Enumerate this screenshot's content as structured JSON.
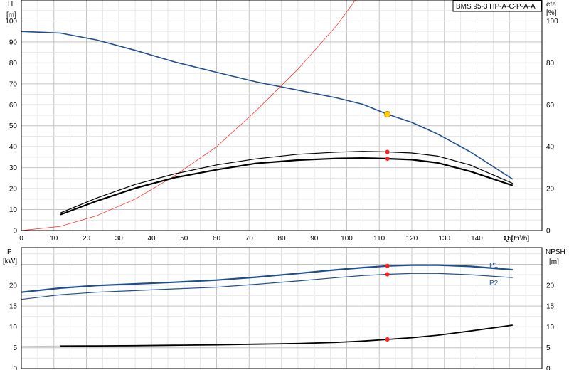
{
  "chart_data": [
    {
      "type": "line",
      "title": "BMS 95-3 HP-A-C-P-A-A",
      "ylabel": "H",
      "yunit": "[m]",
      "y2label": "eta",
      "y2unit": "[%]",
      "xlabel": "Q [m³/h]",
      "xlim": [
        0,
        160
      ],
      "ylim": [
        0,
        110
      ],
      "y2lim": [
        0,
        110
      ],
      "x_ticks": [
        0,
        10,
        20,
        30,
        40,
        50,
        60,
        70,
        80,
        90,
        100,
        110,
        120,
        130,
        140,
        150
      ],
      "y_ticks": [
        0,
        10,
        20,
        30,
        40,
        50,
        60,
        70,
        80,
        90,
        100
      ],
      "y2_ticks": [
        0,
        20,
        40,
        60,
        80,
        100
      ],
      "grid": true,
      "operating_point": {
        "x": 112.5,
        "y": 55.5,
        "color": "#ffcc00"
      },
      "series": [
        {
          "axis": "left",
          "color": "#1f4e8c",
          "width": 1.6,
          "x": [
            0,
            12,
            23,
            35,
            47,
            60,
            72,
            85,
            97,
            105,
            112.5,
            120,
            128,
            138,
            151
          ],
          "values": [
            95,
            94.2,
            91,
            86,
            80.5,
            75.5,
            71,
            67,
            63.3,
            60.2,
            55.5,
            51.6,
            46,
            37.5,
            24.5
          ]
        },
        {
          "axis": "right",
          "color": "#ff2020",
          "width": 0.7,
          "x": [
            0,
            12,
            23,
            35,
            47,
            60,
            72,
            85,
            97,
            105,
            112.5
          ],
          "values": [
            0,
            2,
            7,
            15,
            26,
            40,
            57,
            77,
            98,
            115,
            130
          ]
        },
        {
          "axis": "left",
          "color": "#000000",
          "width": 1.2,
          "x": [
            12,
            23,
            35,
            47,
            60,
            72,
            85,
            97,
            105,
            112.5,
            120,
            128,
            138,
            151
          ],
          "values": [
            8.4,
            15.4,
            22,
            27,
            31.3,
            34.2,
            36.4,
            37.4,
            37.8,
            37.5,
            37,
            35.5,
            31.2,
            22.5
          ]
        },
        {
          "axis": "left",
          "color": "#000000",
          "width": 2.2,
          "x": [
            12,
            23,
            35,
            47,
            60,
            72,
            85,
            97,
            105,
            112.5,
            120,
            128,
            138,
            151
          ],
          "values": [
            7.6,
            14,
            20.2,
            25.2,
            29,
            32,
            33.6,
            34.4,
            34.6,
            34.3,
            33.8,
            32.3,
            28.2,
            21.5
          ]
        }
      ],
      "markers": [
        {
          "x": 112.5,
          "y": 37.5,
          "color": "#ff2020"
        },
        {
          "x": 112.5,
          "y": 34.3,
          "color": "#ff2020"
        }
      ]
    },
    {
      "type": "line",
      "ylabel": "P",
      "yunit": "[kW]",
      "y2label": "NPSH",
      "y2unit": "[m]",
      "xlim": [
        0,
        160
      ],
      "ylim": [
        0,
        29
      ],
      "y2lim": [
        0,
        29
      ],
      "y_ticks": [
        0,
        5,
        10,
        15,
        20
      ],
      "y2_ticks": [
        0,
        5,
        10,
        15,
        20
      ],
      "grid": true,
      "series": [
        {
          "name": "P1",
          "axis": "left",
          "color": "#1f4e8c",
          "width": 2.2,
          "x": [
            0,
            12,
            23,
            35,
            47,
            60,
            72,
            85,
            97,
            105,
            112.5,
            120,
            128,
            138,
            151
          ],
          "values": [
            18.3,
            19.3,
            19.9,
            20.3,
            20.7,
            21.2,
            21.9,
            22.8,
            23.7,
            24.2,
            24.6,
            24.8,
            24.8,
            24.5,
            23.7
          ]
        },
        {
          "name": "P2",
          "axis": "left",
          "color": "#1f4e8c",
          "width": 1.2,
          "x": [
            0,
            12,
            23,
            35,
            47,
            60,
            72,
            85,
            97,
            105,
            112.5,
            120,
            128,
            138,
            151
          ],
          "values": [
            16.6,
            17.7,
            18.3,
            18.7,
            19.1,
            19.5,
            20.2,
            21,
            21.8,
            22.3,
            22.6,
            22.8,
            22.8,
            22.5,
            21.8
          ]
        },
        {
          "axis": "right",
          "color": "#000000",
          "width": 1.8,
          "x": [
            12,
            23,
            35,
            47,
            60,
            72,
            85,
            97,
            105,
            112.5,
            120,
            128,
            138,
            151
          ],
          "values": [
            5.4,
            5.45,
            5.5,
            5.6,
            5.7,
            5.85,
            6,
            6.3,
            6.6,
            7,
            7.4,
            8,
            9,
            10.4
          ]
        },
        {
          "axis": "right",
          "color": "#c0c0c0",
          "width": 1.0,
          "x": [
            0,
            12
          ],
          "values": [
            5.3,
            5.4
          ]
        }
      ],
      "markers": [
        {
          "x": 112.5,
          "y": 24.6,
          "color": "#ff2020"
        },
        {
          "x": 112.5,
          "y": 22.6,
          "color": "#ff2020"
        },
        {
          "x": 112.5,
          "y": 7.0,
          "color": "#ff2020"
        }
      ]
    }
  ]
}
